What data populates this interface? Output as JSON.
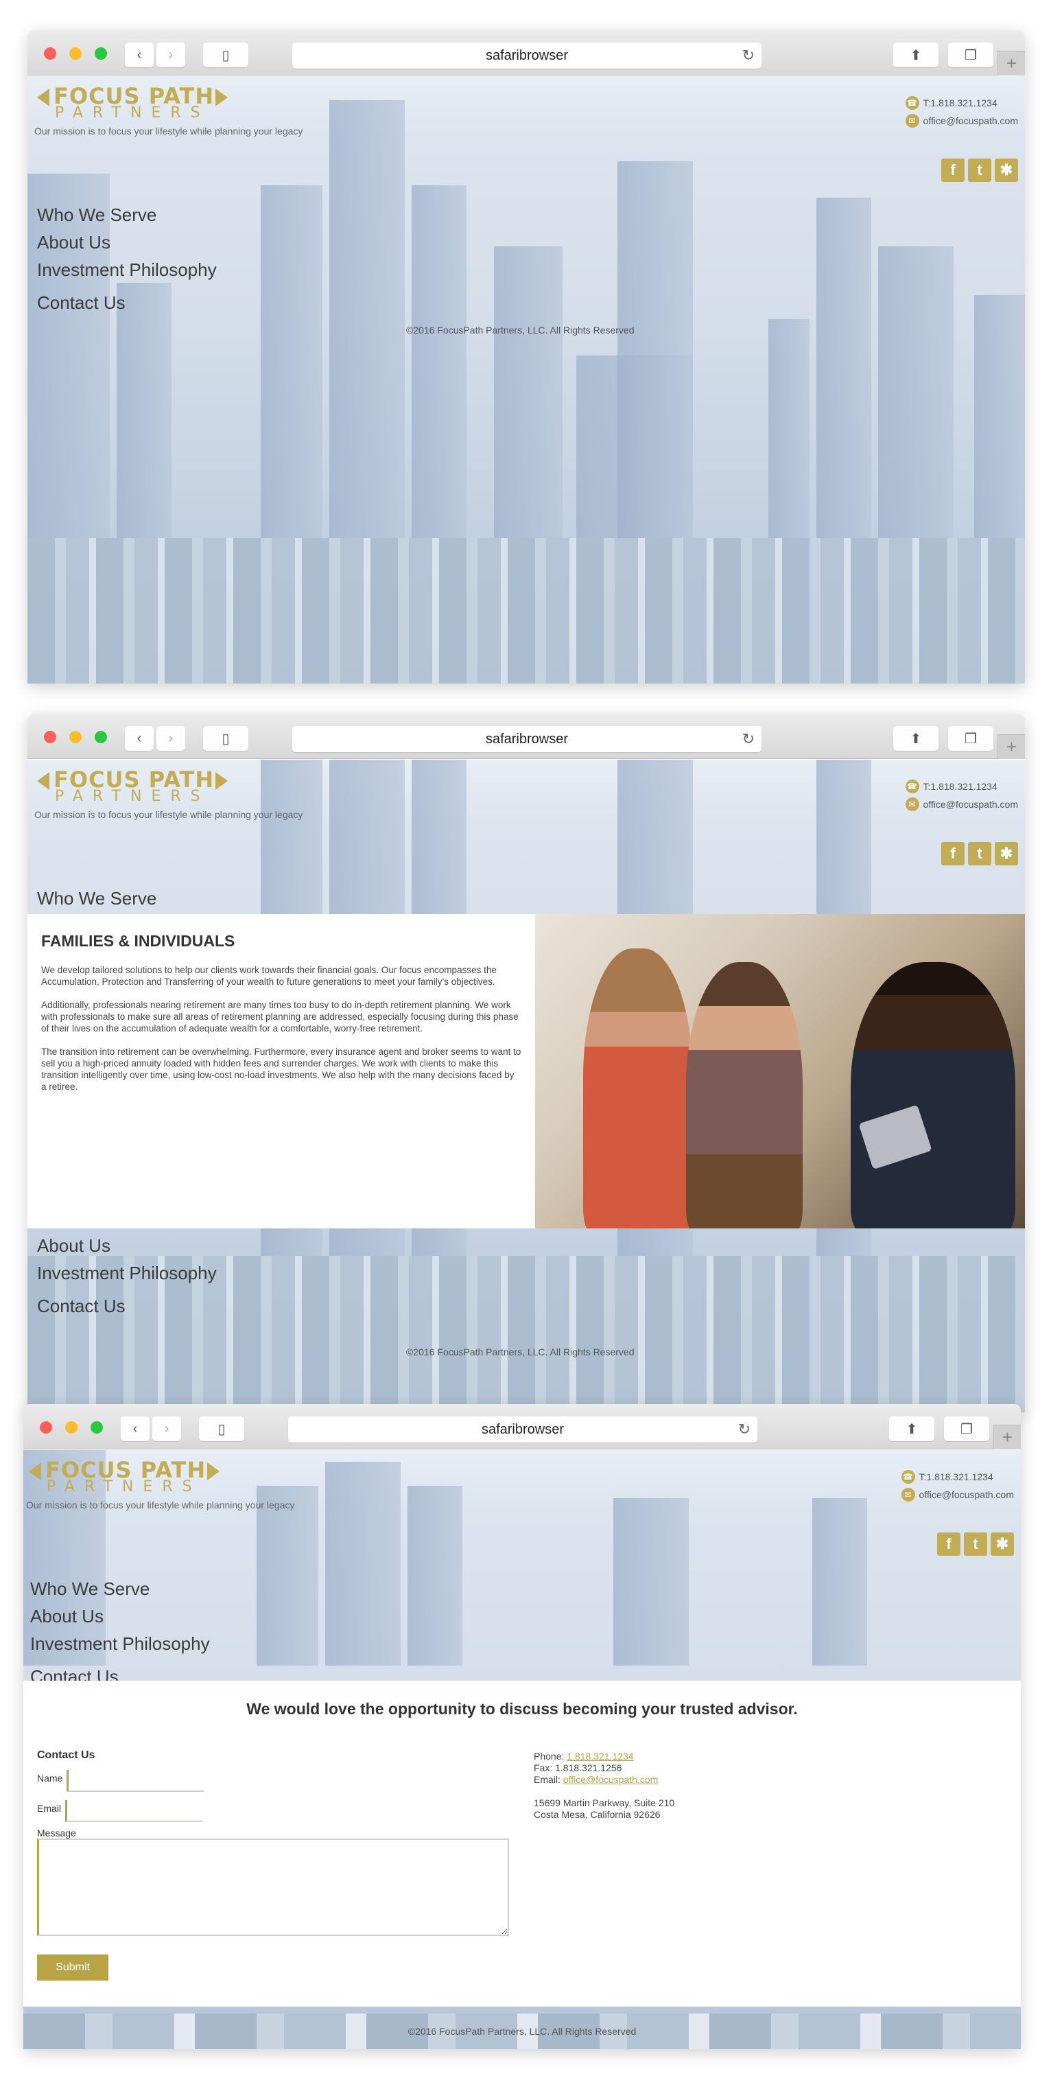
{
  "browser": {
    "address": "safaribrowser",
    "icons": {
      "back": "chevron-left-icon",
      "forward": "chevron-right-icon",
      "sidebar": "sidebar-icon",
      "reload": "reload-icon",
      "share": "share-icon",
      "tabs": "tabs-icon",
      "new_tab": "plus-icon"
    }
  },
  "site": {
    "logo": {
      "main": "FOCUS PATH",
      "sub": "PARTNERS"
    },
    "tagline": "Our mission is to focus your lifestyle while planning your legacy",
    "phone": "T:1.818.321.1234",
    "email": "office@focuspath.com",
    "social": [
      {
        "name": "facebook",
        "glyph": "f"
      },
      {
        "name": "twitter",
        "glyph": "t"
      },
      {
        "name": "yelp",
        "glyph": "✱"
      }
    ],
    "nav": [
      "Who We Serve",
      "About Us",
      "Investment Philosophy",
      "Contact Us"
    ],
    "copyright": "©2016 FocusPath Partners, LLC. All Rights Reserved",
    "accent_color": "#c2ac54"
  },
  "families": {
    "title": "FAMILIES & INDIVIDUALS",
    "paragraphs": [
      "We develop tailored solutions to help our clients work towards their financial goals. Our focus encompasses the Accumulation, Protection and Transferring of your wealth to future generations to meet your family’s objectives.",
      "Additionally, professionals nearing retirement are many times too busy to do in-depth retirement planning. We work with professionals to make sure all areas of retirement planning are addressed, especially focusing during this phase of their lives on the accumulation of adequate wealth for a comfortable, worry-free retirement.",
      "The transition into retirement can be overwhelming. Furthermore, every insurance agent and broker seems to want to sell you a high-priced annuity loaded with hidden fees and surrender charges. We work with clients to make this transition intelligently over time, using low-cost no-load investments. We also help with the many decisions faced by a retiree."
    ],
    "photo_alt": "advisor meeting with couple"
  },
  "contact": {
    "heading": "We would love the opportunity to discuss becoming your trusted advisor.",
    "form_title": "Contact Us",
    "name_label": "Name",
    "name_value": "",
    "email_label": "Email",
    "email_value": "",
    "message_label": "Message",
    "message_value": "",
    "submit_label": "Submit",
    "phone_label": "Phone:",
    "phone": "1.818.321.1234",
    "fax_label": "Fax:",
    "fax": "1.818.321.1256",
    "email_info_label": "Email:",
    "email": "office@focuspath.com",
    "address_line1": "15699 Martin Parkway, Suite 210",
    "address_line2": "Costa Mesa, California 92626"
  }
}
